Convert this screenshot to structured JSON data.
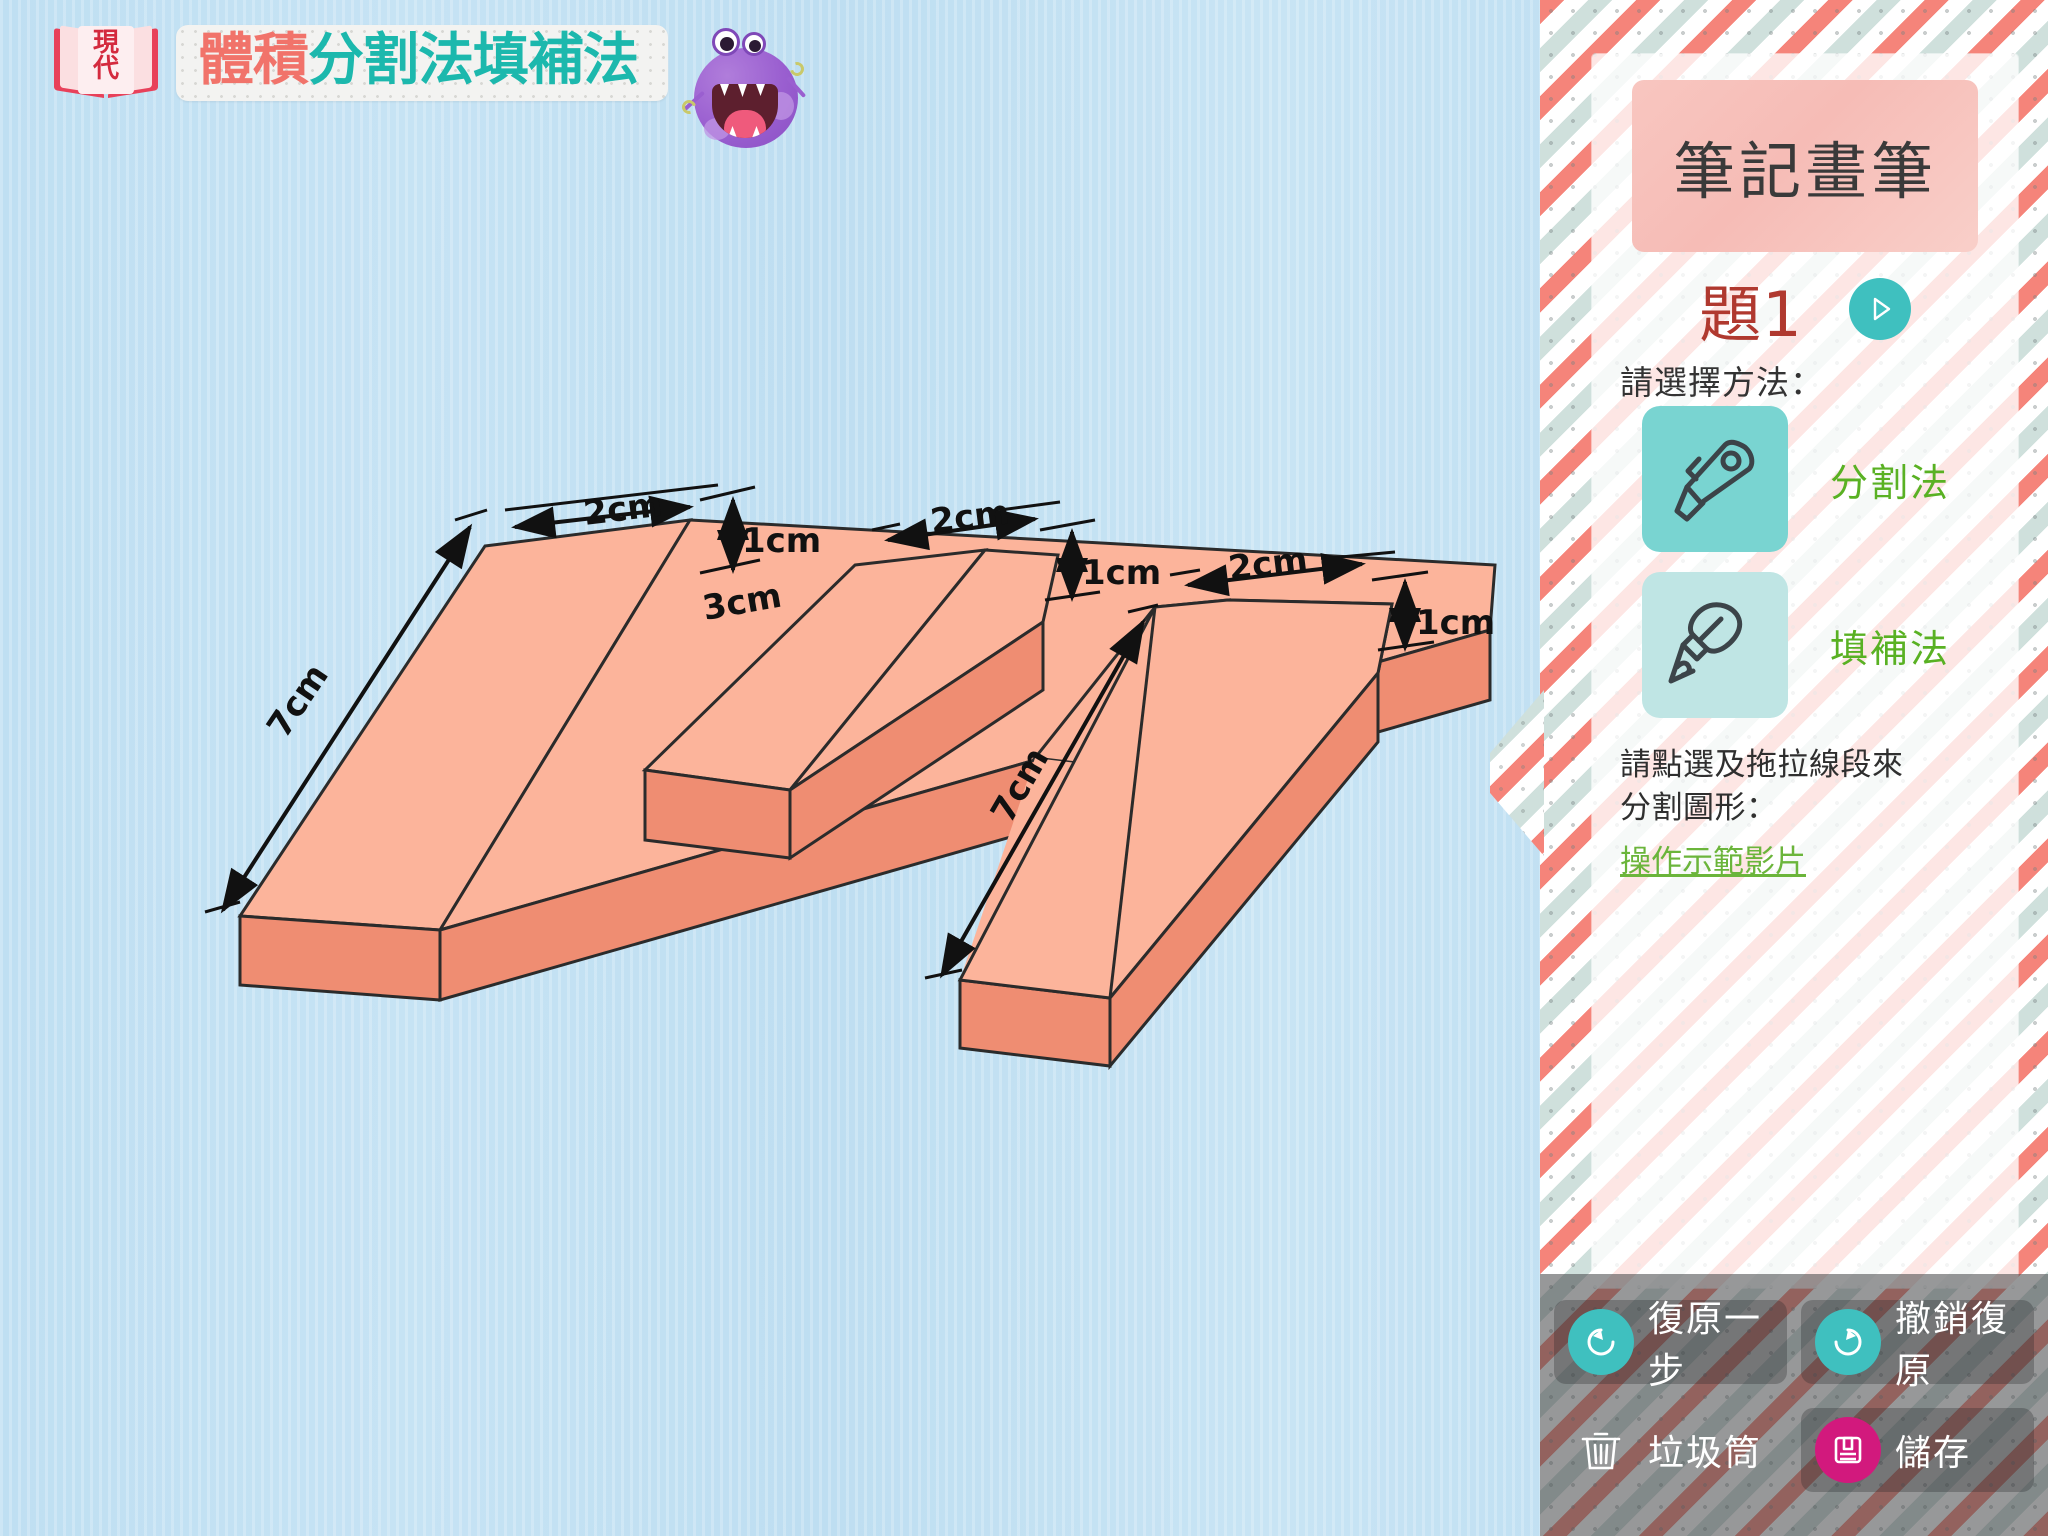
{
  "app": {
    "logo_text_lines": [
      "現",
      "代"
    ],
    "title_part_1": "體積",
    "title_part_2": "分割法填補法",
    "mascot_name": "purple-monster-mascot"
  },
  "canvas": {
    "background_color": "#c2e0f3",
    "shape_fill_top": "#fcb49b",
    "shape_fill_front": "#ef8d72",
    "shape_stroke": "#2b2b2b",
    "boxes": [
      {
        "id": "box-1",
        "labels": {
          "length": "7cm",
          "width": "2cm",
          "height": "1cm",
          "extra": "3cm"
        }
      },
      {
        "id": "box-2",
        "labels": {
          "width": "2cm",
          "height": "1cm"
        }
      },
      {
        "id": "box-3",
        "labels": {
          "length": "7cm",
          "width": "2cm",
          "height": "1cm"
        }
      }
    ]
  },
  "sidebar": {
    "panel_title": "筆記畫筆",
    "question_label": "題1",
    "next_button_icon": "play-triangle-icon",
    "method_prompt": "請選擇方法：",
    "methods": [
      {
        "label": "分割法",
        "icon": "cutter-knife-icon",
        "selected": true
      },
      {
        "label": "填補法",
        "icon": "pen-nib-icon",
        "selected": false
      }
    ],
    "instruction": "請點選及拖拉線段來分割圖形：",
    "demo_link": "操作示範影片",
    "accent_green": "#59b123",
    "accent_teal": "#3fc0bf",
    "accent_red": "#b0392f"
  },
  "toolbar": {
    "buttons": [
      {
        "label": "復原一步",
        "icon": "undo-arrow-icon",
        "style": "teal-circle"
      },
      {
        "label": "撤銷復原",
        "icon": "redo-arrow-icon",
        "style": "teal-circle"
      },
      {
        "label": "垃圾筒",
        "icon": "trash-can-icon",
        "style": "outline"
      },
      {
        "label": "儲存",
        "icon": "floppy-disk-save-icon",
        "style": "pink-circle"
      }
    ]
  }
}
